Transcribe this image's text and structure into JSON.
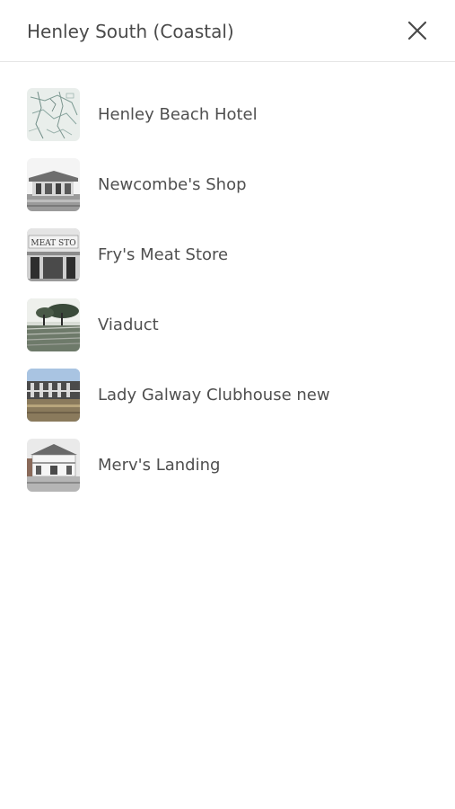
{
  "header": {
    "title": "Henley South (Coastal)",
    "close_icon": "close-icon"
  },
  "list": {
    "items": [
      {
        "label": "Henley Beach Hotel",
        "thumbnail": "map-thumbnail"
      },
      {
        "label": "Newcombe's Shop",
        "thumbnail": "shop-photo-thumbnail"
      },
      {
        "label": "Fry's Meat Store",
        "thumbnail": "storefront-photo-thumbnail",
        "thumbnail_text": "MEAT STO"
      },
      {
        "label": "Viaduct",
        "thumbnail": "viaduct-photo-thumbnail"
      },
      {
        "label": "Lady Galway Clubhouse new",
        "thumbnail": "clubhouse-photo-thumbnail"
      },
      {
        "label": "Merv's Landing",
        "thumbnail": "house-photo-thumbnail"
      }
    ]
  },
  "colors": {
    "text": "#4f4f4f",
    "divider": "#e6e6e6",
    "background": "#ffffff"
  }
}
